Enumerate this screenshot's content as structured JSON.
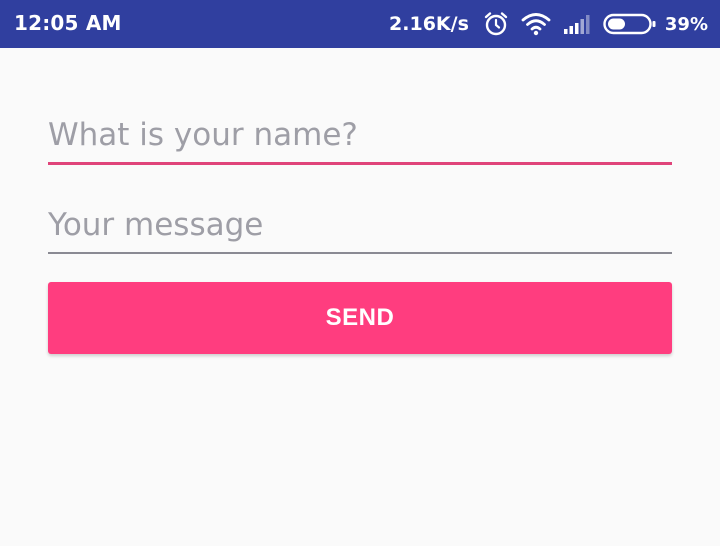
{
  "status_bar": {
    "time": "12:05 AM",
    "network_speed": "2.16K/s",
    "battery_percent": "39%",
    "icons": [
      "alarm-icon",
      "wifi-icon",
      "signal-icon",
      "battery-icon"
    ],
    "background_color": "#303f9f"
  },
  "form": {
    "name_field": {
      "placeholder": "What is your name?",
      "value": "",
      "focused": true
    },
    "message_field": {
      "placeholder": "Your message",
      "value": ""
    },
    "send_button": {
      "label": "SEND"
    }
  },
  "colors": {
    "accent": "#ff3d7f",
    "focused_underline": "#e0447a",
    "background": "#fafafa"
  }
}
